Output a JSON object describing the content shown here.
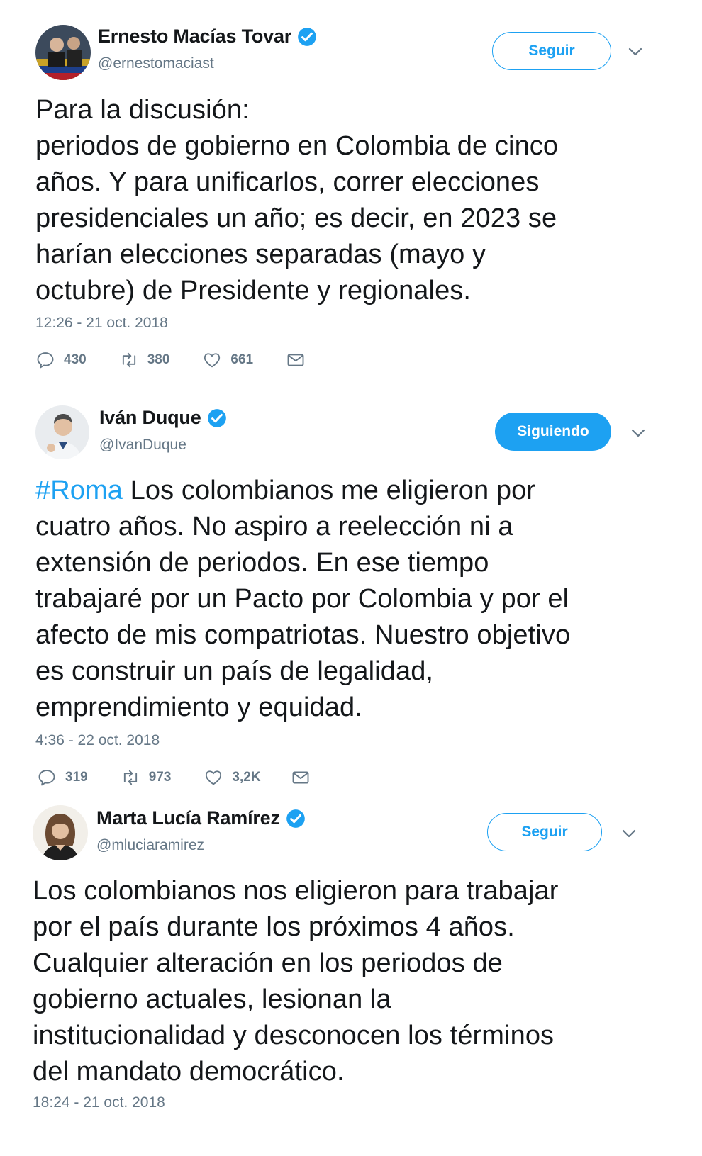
{
  "tweets": [
    {
      "display_name": "Ernesto Macías Tovar",
      "handle": "@ernestomaciast",
      "follow_label": "Seguir",
      "follow_state": "outline",
      "text_lines": [
        "Para la discusión:",
        "periodos de gobierno en Colombia de cinco",
        "años. Y para unificarlos, correr elecciones",
        "presidenciales un año; es decir, en 2023 se",
        "harían elecciones separadas (mayo y",
        "octubre) de Presidente y regionales."
      ],
      "timestamp": "12:26 - 21 oct. 2018",
      "replies": "430",
      "retweets": "380",
      "likes": "661"
    },
    {
      "display_name": "Iván Duque",
      "handle": "@IvanDuque",
      "follow_label": "Siguiendo",
      "follow_state": "filled",
      "hashtag": "#Roma",
      "text_first_line_rest": " Los colombianos me eligieron por",
      "text_lines": [
        "cuatro años. No aspiro a reelección ni a",
        "extensión de periodos. En ese tiempo",
        "trabajaré por un Pacto por Colombia y por el",
        "afecto de mis compatriotas. Nuestro objetivo",
        "es construir un país de legalidad,",
        "emprendimiento y equidad."
      ],
      "timestamp": "4:36 - 22 oct. 2018",
      "replies": "319",
      "retweets": "973",
      "likes": "3,2K"
    },
    {
      "display_name": "Marta Lucía Ramírez",
      "handle": "@mluciaramirez",
      "follow_label": "Seguir",
      "follow_state": "outline",
      "text_lines": [
        "Los colombianos nos eligieron para trabajar",
        "por el país durante los próximos 4 años.",
        "Cualquier alteración en los periodos de",
        "gobierno actuales, lesionan la",
        "institucionalidad y desconocen los términos",
        "del mandato democrático."
      ],
      "timestamp": "18:24 - 21 oct. 2018"
    }
  ],
  "colors": {
    "accent": "#1da1f2",
    "text": "#14171a",
    "secondary": "#657786"
  },
  "icons": {
    "verified": "verified-badge-icon",
    "caret": "chevron-down-icon",
    "reply": "reply-icon",
    "retweet": "retweet-icon",
    "like": "heart-icon",
    "dm": "envelope-icon"
  }
}
